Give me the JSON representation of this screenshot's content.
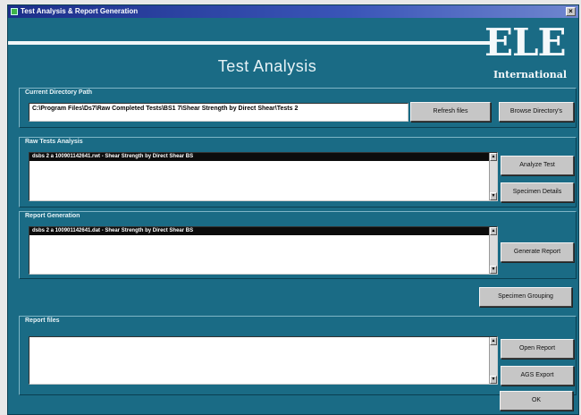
{
  "window": {
    "title": "Test Analysis & Report Generation",
    "close_glyph": "×"
  },
  "header": {
    "title": "Test Analysis",
    "logo_main": "ELE",
    "logo_sub": "International"
  },
  "current_path": {
    "label": "Current Directory Path",
    "value": "C:\\Program Files\\Ds7\\Raw Completed Tests\\BS1 7\\Shear Strength by Direct Shear\\Tests 2",
    "refresh_button": "Refresh files",
    "browse_button": "Browse Directory's"
  },
  "raw_tests": {
    "label": "Raw Tests Analysis",
    "items": [
      "dsbs 2 a 100901142641.rwt - Shear Strength by Direct Shear BS"
    ],
    "analyze_button": "Analyze Test",
    "specimen_button": "Specimen Details"
  },
  "report_generation": {
    "label": "Report Generation",
    "items": [
      "dsbs 2 a 100901142641.dat - Shear Strength by Direct Shear BS"
    ],
    "generate_button": "Generate Report"
  },
  "specimen_grouping_button": "Specimen Grouping",
  "report_files": {
    "label": "Report files",
    "open_button": "Open Report",
    "export_button": "AGS Export",
    "ok_button": "OK"
  },
  "colors": {
    "panel_bg": "#1a6b85",
    "title_bar": "#1c2f8a",
    "selection": "#0c0c0c"
  }
}
